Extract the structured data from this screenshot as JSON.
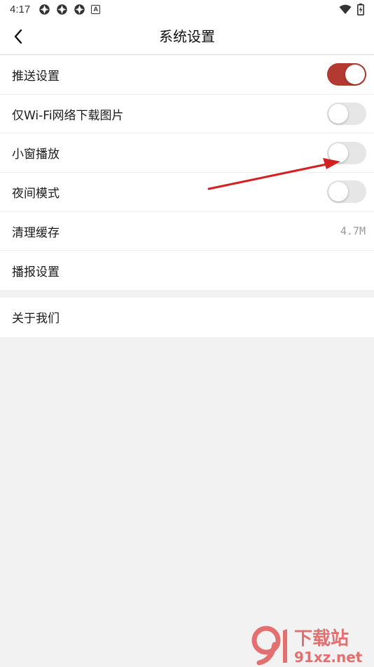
{
  "status_bar": {
    "time": "4:17",
    "left_icons": [
      "app-notification-icon",
      "app-notification-icon",
      "app-notification-icon",
      "a-letter-icon"
    ],
    "right_icons": [
      "wifi-icon",
      "battery-charging-icon"
    ]
  },
  "header": {
    "title": "系统设置",
    "back_icon": "chevron-left-icon"
  },
  "settings": {
    "items": [
      {
        "label": "推送设置",
        "control": "toggle",
        "on": true
      },
      {
        "label": "仅Wi-Fi网络下载图片",
        "control": "toggle",
        "on": false
      },
      {
        "label": "小窗播放",
        "control": "toggle",
        "on": false
      },
      {
        "label": "夜间模式",
        "control": "toggle",
        "on": false
      },
      {
        "label": "清理缓存",
        "control": "value",
        "value": "4.7M"
      },
      {
        "label": "播报设置",
        "control": "none"
      }
    ],
    "about": {
      "label": "关于我们"
    }
  },
  "annotation": {
    "type": "red-arrow",
    "color": "#d42020",
    "points_to": "小窗播放 toggle"
  },
  "watermark": {
    "top": "下载站",
    "bottom": "91xz.net",
    "logo": "91"
  },
  "colors": {
    "accent_toggle_on": "#b33a30",
    "toggle_off": "#e6e6e6",
    "background": "#f2f2f2",
    "surface": "#ffffff"
  }
}
